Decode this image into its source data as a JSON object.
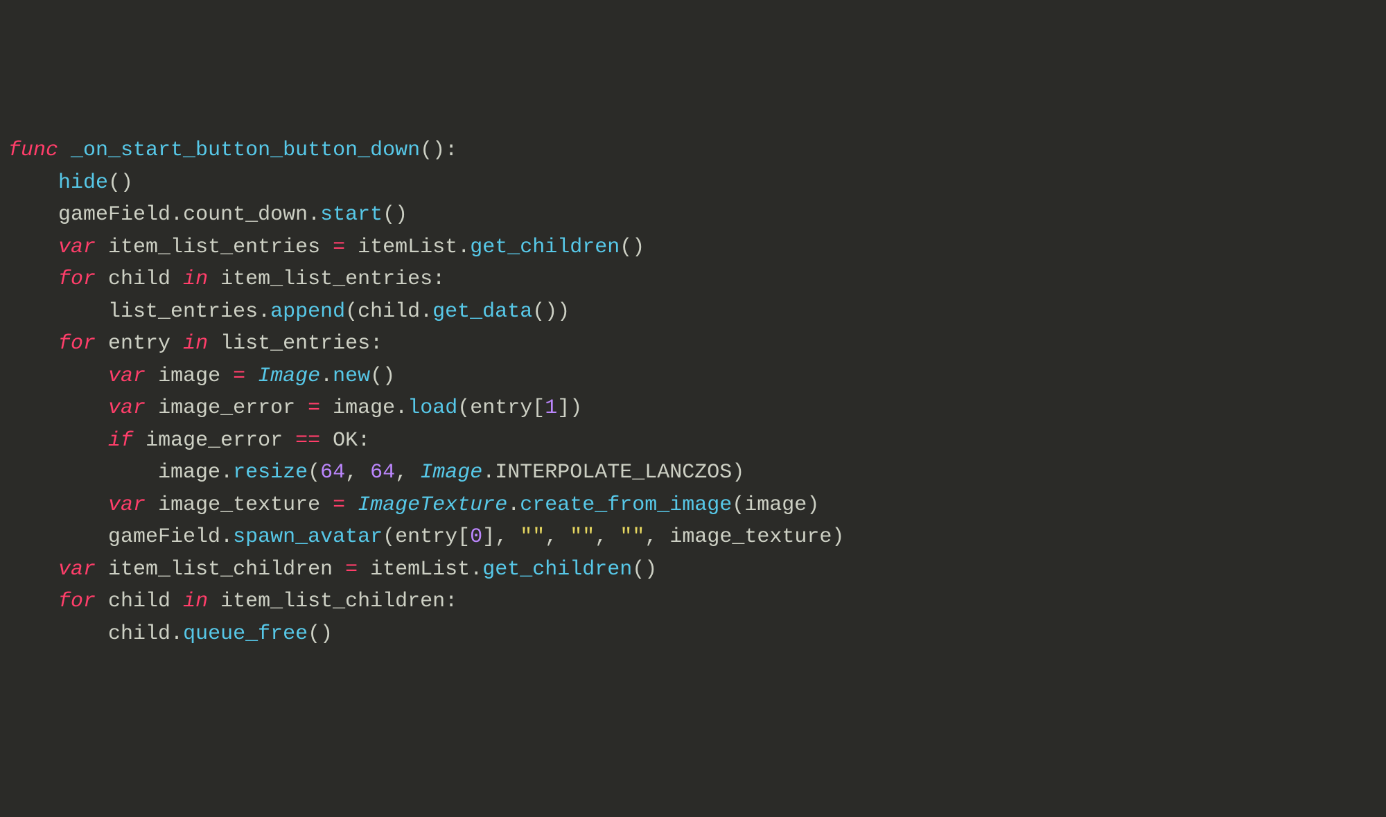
{
  "code": {
    "l1": {
      "func": "func",
      "name": "_on_start_button_button_down",
      "p1": "(",
      "p2": ")",
      "colon": ":"
    },
    "l2": {
      "hide": "hide",
      "p1": "(",
      "p2": ")"
    },
    "l3": {
      "gf": "gameField",
      "dot1": ".",
      "cd": "count_down",
      "dot2": ".",
      "start": "start",
      "p1": "(",
      "p2": ")"
    },
    "l4": {
      "var": "var",
      "ile": "item_list_entries",
      "eq": "=",
      "il": "itemList",
      "dot": ".",
      "gc": "get_children",
      "p1": "(",
      "p2": ")"
    },
    "l5": {
      "for": "for",
      "child": "child",
      "in": "in",
      "ile": "item_list_entries",
      "colon": ":"
    },
    "l6": {
      "le": "list_entries",
      "dot1": ".",
      "append": "append",
      "p1": "(",
      "child": "child",
      "dot2": ".",
      "gd": "get_data",
      "p2": "(",
      "p3": ")",
      "p4": ")"
    },
    "l7": {
      "for": "for",
      "entry": "entry",
      "in": "in",
      "le": "list_entries",
      "colon": ":"
    },
    "l8": {
      "var": "var",
      "image": "image",
      "eq": "=",
      "Image": "Image",
      "dot": ".",
      "new": "new",
      "p1": "(",
      "p2": ")"
    },
    "l9": {
      "var": "var",
      "ie": "image_error",
      "eq": "=",
      "image": "image",
      "dot": ".",
      "load": "load",
      "p1": "(",
      "entry": "entry",
      "b1": "[",
      "one": "1",
      "b2": "]",
      "p2": ")"
    },
    "l10": {
      "if": "if",
      "ie": "image_error",
      "eqeq": "==",
      "ok": "OK",
      "colon": ":"
    },
    "l11": {
      "image": "image",
      "dot": ".",
      "resize": "resize",
      "p1": "(",
      "n1": "64",
      "c1": ",",
      "n2": "64",
      "c2": ",",
      "Image": "Image",
      "dot2": ".",
      "il": "INTERPOLATE_LANCZOS",
      "p2": ")"
    },
    "l12": {
      "var": "var",
      "it": "image_texture",
      "eq": "=",
      "IT": "ImageTexture",
      "dot": ".",
      "cfi": "create_from_image",
      "p1": "(",
      "image": "image",
      "p2": ")"
    },
    "l13": {
      "gf": "gameField",
      "dot": ".",
      "sa": "spawn_avatar",
      "p1": "(",
      "entry": "entry",
      "b1": "[",
      "zero": "0",
      "b2": "]",
      "c1": ",",
      "s1": "\"\"",
      "c2": ",",
      "s2": "\"\"",
      "c3": ",",
      "s3": "\"\"",
      "c4": ",",
      "it": "image_texture",
      "p2": ")"
    },
    "l14": {
      "var": "var",
      "ilc": "item_list_children",
      "eq": "=",
      "il": "itemList",
      "dot": ".",
      "gc": "get_children",
      "p1": "(",
      "p2": ")"
    },
    "l15": {
      "for": "for",
      "child": "child",
      "in": "in",
      "ilc": "item_list_children",
      "colon": ":"
    },
    "l16": {
      "child": "child",
      "dot": ".",
      "qf": "queue_free",
      "p1": "(",
      "p2": ")"
    }
  }
}
